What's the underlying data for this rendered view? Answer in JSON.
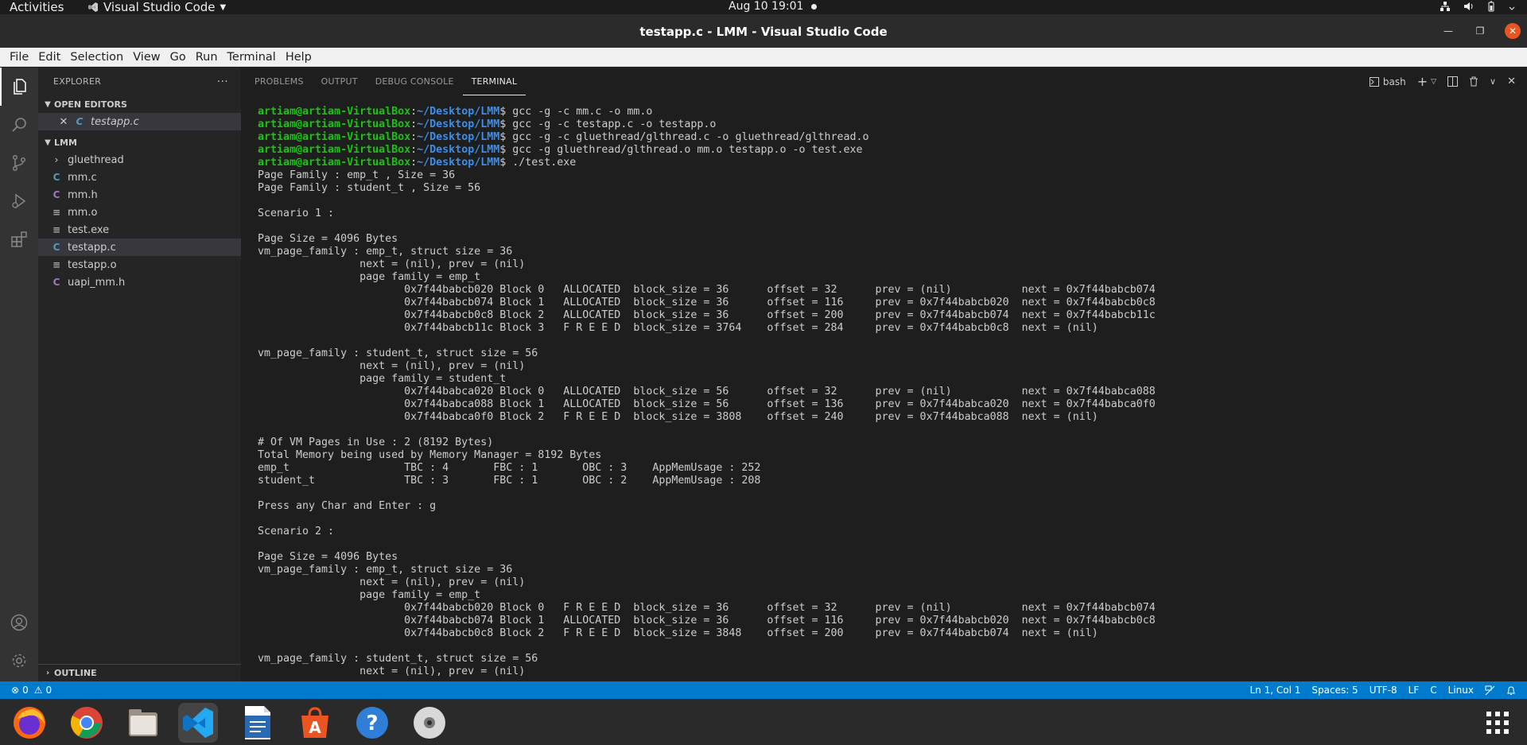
{
  "gnome_bar": {
    "activities": "Activities",
    "app_name": "Visual Studio Code",
    "datetime": "Aug 10  19:01"
  },
  "window": {
    "title": "testapp.c - LMM - Visual Studio Code"
  },
  "menu": [
    "File",
    "Edit",
    "Selection",
    "View",
    "Go",
    "Run",
    "Terminal",
    "Help"
  ],
  "sidebar": {
    "header": "EXPLORER",
    "open_editors_label": "OPEN EDITORS",
    "open_editors": [
      {
        "name": "testapp.c",
        "icon": "C"
      }
    ],
    "folder_label": "LMM",
    "items": [
      {
        "name": "gluethread",
        "type": "folder"
      },
      {
        "name": "mm.c",
        "icon": "C"
      },
      {
        "name": "mm.h",
        "icon": "C"
      },
      {
        "name": "mm.o",
        "icon": "≡"
      },
      {
        "name": "test.exe",
        "icon": "≡"
      },
      {
        "name": "testapp.c",
        "icon": "C"
      },
      {
        "name": "testapp.o",
        "icon": "≡"
      },
      {
        "name": "uapi_mm.h",
        "icon": "C"
      }
    ],
    "outline_label": "OUTLINE"
  },
  "panel": {
    "tabs": [
      "PROBLEMS",
      "OUTPUT",
      "DEBUG CONSOLE",
      "TERMINAL"
    ],
    "active_tab": "TERMINAL",
    "shell": "bash"
  },
  "terminal": {
    "prompt_user": "artiam@artiam-VirtualBox",
    "prompt_path": "~/Desktop/LMM",
    "commands": [
      "gcc -g -c mm.c -o mm.o",
      "gcc -g -c testapp.c -o testapp.o",
      "gcc -g -c gluethread/glthread.c -o gluethread/glthread.o",
      "gcc -g gluethread/glthread.o mm.o testapp.o -o test.exe",
      "./test.exe"
    ],
    "output": [
      "Page Family : emp_t , Size = 36",
      "Page Family : student_t , Size = 56",
      "",
      "Scenario 1 :",
      "",
      "Page Size = 4096 Bytes",
      "vm_page_family : emp_t, struct size = 36",
      "                next = (nil), prev = (nil)",
      "                page family = emp_t",
      "                       0x7f44babcb020 Block 0   ALLOCATED  block_size = 36      offset = 32      prev = (nil)           next = 0x7f44babcb074",
      "                       0x7f44babcb074 Block 1   ALLOCATED  block_size = 36      offset = 116     prev = 0x7f44babcb020  next = 0x7f44babcb0c8",
      "                       0x7f44babcb0c8 Block 2   ALLOCATED  block_size = 36      offset = 200     prev = 0x7f44babcb074  next = 0x7f44babcb11c",
      "                       0x7f44babcb11c Block 3   F R E E D  block_size = 3764    offset = 284     prev = 0x7f44babcb0c8  next = (nil)",
      "",
      "vm_page_family : student_t, struct size = 56",
      "                next = (nil), prev = (nil)",
      "                page family = student_t",
      "                       0x7f44babca020 Block 0   ALLOCATED  block_size = 56      offset = 32      prev = (nil)           next = 0x7f44babca088",
      "                       0x7f44babca088 Block 1   ALLOCATED  block_size = 56      offset = 136     prev = 0x7f44babca020  next = 0x7f44babca0f0",
      "                       0x7f44babca0f0 Block 2   F R E E D  block_size = 3808    offset = 240     prev = 0x7f44babca088  next = (nil)",
      "",
      "# Of VM Pages in Use : 2 (8192 Bytes)",
      "Total Memory being used by Memory Manager = 8192 Bytes",
      "emp_t                  TBC : 4       FBC : 1       OBC : 3    AppMemUsage : 252",
      "student_t              TBC : 3       FBC : 1       OBC : 2    AppMemUsage : 208",
      "",
      "Press any Char and Enter : g",
      "",
      "Scenario 2 :",
      "",
      "Page Size = 4096 Bytes",
      "vm_page_family : emp_t, struct size = 36",
      "                next = (nil), prev = (nil)",
      "                page family = emp_t",
      "                       0x7f44babcb020 Block 0   F R E E D  block_size = 36      offset = 32      prev = (nil)           next = 0x7f44babcb074",
      "                       0x7f44babcb074 Block 1   ALLOCATED  block_size = 36      offset = 116     prev = 0x7f44babcb020  next = 0x7f44babcb0c8",
      "                       0x7f44babcb0c8 Block 2   F R E E D  block_size = 3848    offset = 200     prev = 0x7f44babcb074  next = (nil)",
      "",
      "vm_page_family : student_t, struct size = 56",
      "                next = (nil), prev = (nil)"
    ]
  },
  "statusbar": {
    "errors": "0",
    "warnings": "0",
    "position": "Ln 1, Col 1",
    "spaces": "Spaces: 5",
    "encoding": "UTF-8",
    "eol": "LF",
    "language": "C",
    "platform": "Linux"
  },
  "dock": {
    "items": [
      "firefox-icon",
      "chrome-icon",
      "files-icon",
      "vscode-icon",
      "writer-icon",
      "software-icon",
      "help-icon",
      "disc-icon"
    ]
  }
}
